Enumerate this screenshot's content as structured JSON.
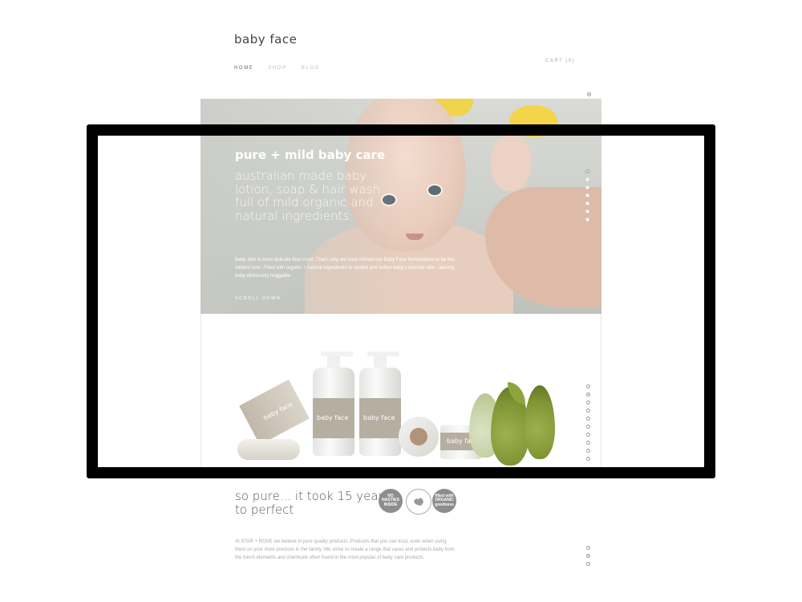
{
  "site": {
    "logo": "baby face",
    "nav": [
      {
        "label": "HOME",
        "active": true
      },
      {
        "label": "SHOP",
        "active": false
      },
      {
        "label": "BLOG",
        "active": false
      }
    ],
    "cart": "CART (0)"
  },
  "hero": {
    "title": "pure + mild baby care",
    "subtitle": "australian made baby lotion, soap & hair wash full of mild organic and natural ingredients",
    "description": "Baby skin is more delicate than most. That's why we have refined our Baby Face formulations to be the mildest ever. Filled with organic + natural ingredients to soothe and soften baby's delicate skin - leaving baby deliciously huggable.",
    "scroll_label": "SCROLL DOWN"
  },
  "products": {
    "items": [
      {
        "name": "baby face",
        "type": "soap box"
      },
      {
        "name": "baby face",
        "type": "hair + body wash"
      },
      {
        "name": "baby face",
        "type": "body milk"
      },
      {
        "name": "baby face",
        "type": "bum balm"
      }
    ]
  },
  "about": {
    "heading": "so pure... it took 15 years to perfect",
    "badges": [
      {
        "text": "NO NASTIES INSIDE",
        "style": "filled"
      },
      {
        "text": "",
        "style": "outline",
        "icon": "australia-icon"
      },
      {
        "text": "filled with ORGANIC goodness",
        "style": "filled"
      }
    ],
    "body": "At STAR + ROSE we believe in pure quality products. Products that you can trust, even when using them on your most precious in the family. We strive to create a range that cares and protects baby from the harsh elements and chemicals often found in the most popular of baby care products."
  }
}
